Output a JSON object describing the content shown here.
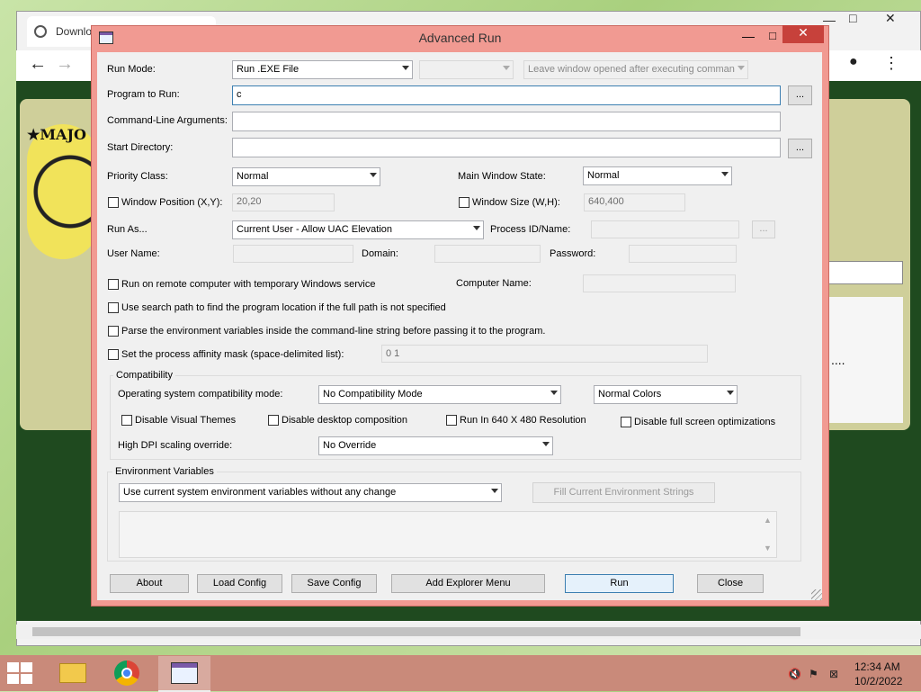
{
  "browser": {
    "tab_label": "Downlo",
    "logo_text": "★MAJO",
    "dots": "....",
    "controls": {
      "minimize": "—",
      "maximize": "□",
      "close": "✕",
      "back": "←",
      "forward": "→",
      "refresh": "↻",
      "menu": "⋮",
      "account": "●"
    }
  },
  "dialog": {
    "title": "Advanced Run",
    "minimize": "—",
    "maximize": "□",
    "close": "✕",
    "run_mode_label": "Run Mode:",
    "run_mode_value": "Run .EXE File",
    "run_mode_sub_value": "",
    "leave_window_value": "Leave window opened after executing comman",
    "program_label": "Program to Run:",
    "program_value": "c",
    "browse": "...",
    "args_label": "Command-Line Arguments:",
    "args_value": "",
    "startdir_label": "Start Directory:",
    "startdir_value": "",
    "priority_label": "Priority Class:",
    "priority_value": "Normal",
    "mainwin_label": "Main Window State:",
    "mainwin_value": "Normal",
    "winpos_label": "Window Position (X,Y):",
    "winpos_value": "20,20",
    "winsize_label": "Window Size (W,H):",
    "winsize_value": "640,400",
    "runas_label": "Run As...",
    "runas_value": "Current User - Allow UAC Elevation",
    "procid_label": "Process ID/Name:",
    "username_label": "User Name:",
    "domain_label": "Domain:",
    "password_label": "Password:",
    "remote_label": "Run on remote computer with temporary Windows service",
    "computer_label": "Computer Name:",
    "searchpath_label": "Use search path to find the program location if the full path is not specified",
    "parseenv_label": "Parse the environment variables inside the command-line string before passing it to the program.",
    "affinity_label": "Set the process affinity mask (space-delimited list):",
    "affinity_value": "0 1",
    "compat_group": "Compatibility",
    "compat_os_label": "Operating system compatibility mode:",
    "compat_os_value": "No Compatibility Mode",
    "compat_colors_value": "Normal Colors",
    "disable_themes": "Disable Visual Themes",
    "disable_desktop": "Disable desktop composition",
    "run640": "Run In 640 X 480 Resolution",
    "disable_fullscreen": "Disable full screen optimizations",
    "dpi_label": "High DPI scaling override:",
    "dpi_value": "No Override",
    "env_group": "Environment Variables",
    "env_value": "Use current system environment variables without any change",
    "fill_env": "Fill Current Environment Strings",
    "buttons": {
      "about": "About",
      "load": "Load Config",
      "save": "Save Config",
      "explorer": "Add Explorer Menu",
      "run": "Run",
      "close": "Close"
    }
  },
  "taskbar": {
    "time": "12:34 AM",
    "date": "10/2/2022"
  }
}
